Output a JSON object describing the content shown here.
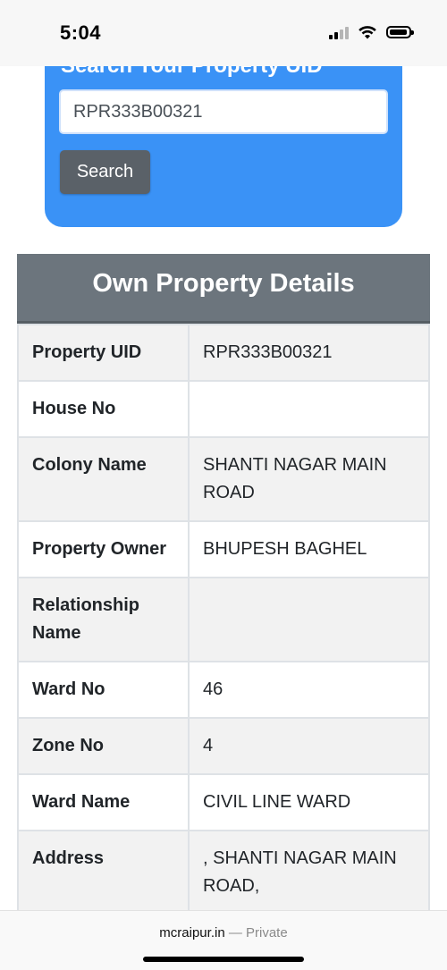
{
  "status_bar": {
    "time": "5:04"
  },
  "search": {
    "heading": "Search Your Property UID",
    "input_value": "RPR333B00321",
    "button_label": "Search"
  },
  "details": {
    "title": "Own Property Details",
    "rows": [
      {
        "label": "Property UID",
        "value": "RPR333B00321"
      },
      {
        "label": "House No",
        "value": ""
      },
      {
        "label": "Colony Name",
        "value": "SHANTI NAGAR MAIN ROAD"
      },
      {
        "label": "Property Owner",
        "value": "BHUPESH BAGHEL"
      },
      {
        "label": "Relationship Name",
        "value": ""
      },
      {
        "label": "Ward No",
        "value": "46"
      },
      {
        "label": "Zone No",
        "value": "4"
      },
      {
        "label": "Ward Name",
        "value": "CIVIL LINE WARD"
      },
      {
        "label": "Address",
        "value": ", SHANTI NAGAR MAIN ROAD,"
      },
      {
        "label": "",
        "value": ""
      }
    ]
  },
  "browser": {
    "domain": "mcraipur.in",
    "privacy": "— Private"
  }
}
